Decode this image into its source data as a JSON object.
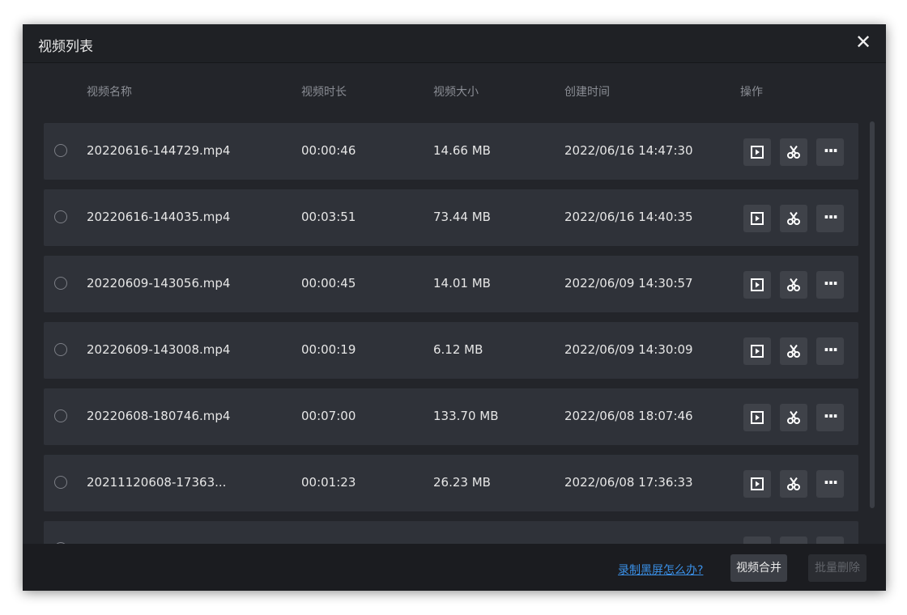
{
  "dialog": {
    "title": "视频列表"
  },
  "columns": {
    "name": "视频名称",
    "duration": "视频时长",
    "size": "视频大小",
    "created": "创建时间",
    "actions": "操作"
  },
  "rows": [
    {
      "name": "20220616-144729.mp4",
      "duration": "00:00:46",
      "size": "14.66 MB",
      "created": "2022/06/16 14:47:30"
    },
    {
      "name": "20220616-144035.mp4",
      "duration": "00:03:51",
      "size": "73.44 MB",
      "created": "2022/06/16 14:40:35"
    },
    {
      "name": "20220609-143056.mp4",
      "duration": "00:00:45",
      "size": "14.01 MB",
      "created": "2022/06/09 14:30:57"
    },
    {
      "name": "20220609-143008.mp4",
      "duration": "00:00:19",
      "size": "6.12 MB",
      "created": "2022/06/09 14:30:09"
    },
    {
      "name": "20220608-180746.mp4",
      "duration": "00:07:00",
      "size": "133.70 MB",
      "created": "2022/06/08 18:07:46"
    },
    {
      "name": "20211120608-17363...",
      "duration": "00:01:23",
      "size": "26.23 MB",
      "created": "2022/06/08 17:36:33"
    },
    {
      "name": "",
      "duration": "",
      "size": "",
      "created": ""
    }
  ],
  "footer": {
    "help_link": "录制黑屏怎么办?",
    "merge_label": "视频合并",
    "delete_label": "批量删除"
  },
  "icons": {
    "close": "close-icon",
    "play": "play-icon",
    "cut": "scissors-icon",
    "more": "more-icon",
    "more_glyph": "···"
  },
  "colors": {
    "dialog_bg": "#23252a",
    "row_bg": "#2f3239",
    "link": "#3a8fe6"
  }
}
